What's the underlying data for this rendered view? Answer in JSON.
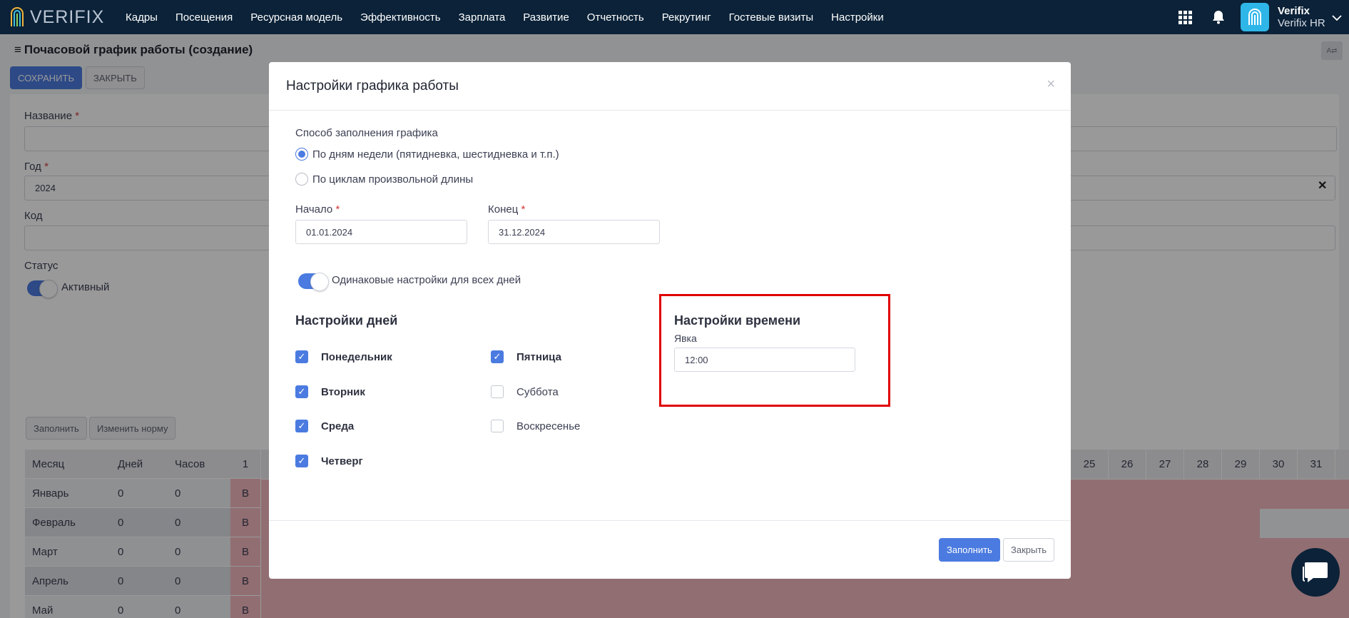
{
  "nav": {
    "logo": "VERIFIX",
    "menu": [
      "Кадры",
      "Посещения",
      "Ресурсная модель",
      "Эффективность",
      "Зарплата",
      "Развитие",
      "Отчетность",
      "Рекрутинг",
      "Гостевые визиты",
      "Настройки"
    ],
    "user_name": "Verifix",
    "user_company": "Verifix HR"
  },
  "page": {
    "title": "Почасовой график работы (создание)",
    "save_button": "СОХРАНИТЬ",
    "close_button": "ЗАКРЫТЬ",
    "name_label": "Название",
    "name_value": "",
    "year_label": "Год",
    "year_value": "2024",
    "code_label": "Код",
    "code_value": "",
    "status_label": "Статус",
    "status_value": "Активный",
    "fill_button": "Заполнить",
    "norm_button": "Изменить норму"
  },
  "table": {
    "headers": {
      "month": "Месяц",
      "days": "Дней",
      "hours": "Часов"
    },
    "day_left": "1",
    "days_right": [
      "25",
      "26",
      "27",
      "28",
      "29",
      "30",
      "31"
    ],
    "rows": [
      {
        "month": "Январь",
        "days": "0",
        "hours": "0"
      },
      {
        "month": "Февраль",
        "days": "0",
        "hours": "0"
      },
      {
        "month": "Март",
        "days": "0",
        "hours": "0"
      },
      {
        "month": "Апрель",
        "days": "0",
        "hours": "0"
      },
      {
        "month": "Май",
        "days": "0",
        "hours": "0"
      }
    ],
    "weekend_mark": "В"
  },
  "modal": {
    "title": "Настройки графика работы",
    "fill_method_label": "Способ заполнения графика",
    "option_weekdays": "По дням недели (пятидневка, шестидневка и т.п.)",
    "option_cycles": "По циклам произвольной длины",
    "start_label": "Начало",
    "start_value": "01.01.2024",
    "end_label": "Конец",
    "end_value": "31.12.2024",
    "same_settings_label": "Одинаковые настройки для всех дней",
    "days_settings_title": "Настройки дней",
    "days": [
      {
        "label": "Понедельник",
        "checked": true
      },
      {
        "label": "Вторник",
        "checked": true
      },
      {
        "label": "Среда",
        "checked": true
      },
      {
        "label": "Четверг",
        "checked": true
      },
      {
        "label": "Пятница",
        "checked": true
      },
      {
        "label": "Суббота",
        "checked": false
      },
      {
        "label": "Воскресенье",
        "checked": false
      }
    ],
    "time_settings_title": "Настройки времени",
    "arrival_label": "Явка",
    "arrival_value": "12:00",
    "fill_button": "Заполнить",
    "close_button": "Закрыть"
  }
}
